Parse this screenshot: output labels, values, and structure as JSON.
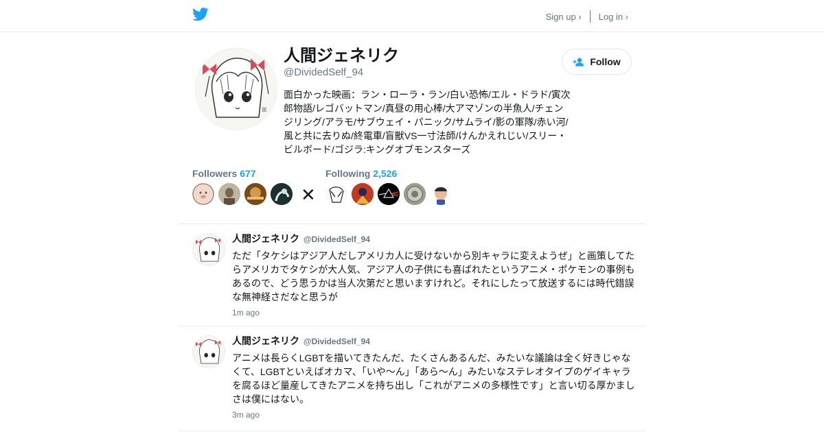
{
  "header": {
    "sign_up": "Sign up ›",
    "log_in": "Log in ›"
  },
  "profile": {
    "name": "人間ジェネリク",
    "handle": "@DividedSelf_94",
    "bio": "面白かった映画：ラン・ローラ・ラン/白い恐怖/エル・ドラド/寅次郎物語/レゴバットマン/真昼の用心棒/大アマゾンの半魚人/チェンジリング/アラモ/サブウェイ・パニック/サムライ/影の軍隊/赤い河/風と共に去りぬ/終電車/盲獣VS一寸法師/けんかえれじい/スリー・ビルボード/ゴジラ:キングオブモンスターズ",
    "follow_label": "Follow"
  },
  "stats": {
    "followers_label": "Followers",
    "followers_count": "677",
    "following_label": "Following",
    "following_count": "2,526",
    "separator": "✕"
  },
  "tweets": [
    {
      "name": "人間ジェネリク",
      "handle": "@DividedSelf_94",
      "text": "ただ「タケシはアジア人だしアメリカ人に受けないから別キャラに変えようぜ」と画策してたらアメリカでタケシが大人気、アジア人の子供にも喜ばれたというアニメ・ポケモンの事例もあるので、どう思うかは当人次第だと思いますけれど。それにしたって放送するには時代錯誤な無神経さだなと思うが",
      "time": "1m ago"
    },
    {
      "name": "人間ジェネリク",
      "handle": "@DividedSelf_94",
      "text": "アニメは長らくLGBTを描いてきたんだ、たくさんあるんだ、みたいな議論は全く好きじゃなくて、LGBTといえばオカマ、「いや～ん」「あら～ん」みたいなステレオタイプのゲイキャラを腐るほど量産してきたアニメを持ち出し「これがアニメの多様性です」と言い切る厚かましさは僕にはない。",
      "time": "3m ago"
    }
  ],
  "colors": {
    "accent": "#1da1f2",
    "muted": "#657786",
    "text": "#14171a",
    "border": "#e1e8ed"
  },
  "icons": {
    "logo": "twitter-bird-icon",
    "follow": "add-user-icon"
  }
}
